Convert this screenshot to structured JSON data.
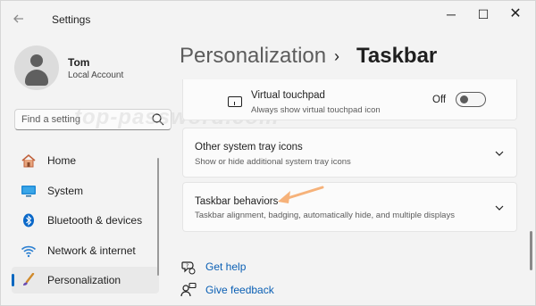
{
  "window": {
    "title": "Settings",
    "controls": {
      "minimize": "─",
      "maximize": "☐",
      "close": "✕"
    }
  },
  "profile": {
    "name": "Tom",
    "account_type": "Local Account"
  },
  "search": {
    "placeholder": "Find a setting"
  },
  "watermark": "top-password.com",
  "sidebar": {
    "items": [
      {
        "label": "Home",
        "icon": "home-icon",
        "active": false
      },
      {
        "label": "System",
        "icon": "system-icon",
        "active": false
      },
      {
        "label": "Bluetooth & devices",
        "icon": "bluetooth-icon",
        "active": false
      },
      {
        "label": "Network & internet",
        "icon": "wifi-icon",
        "active": false
      },
      {
        "label": "Personalization",
        "icon": "brush-icon",
        "active": true
      }
    ]
  },
  "breadcrumb": {
    "parent": "Personalization",
    "separator": "›",
    "current": "Taskbar"
  },
  "settings": {
    "virtual_touchpad": {
      "title": "Virtual touchpad",
      "subtitle": "Always show virtual touchpad icon",
      "state_label": "Off"
    },
    "other_tray": {
      "title": "Other system tray icons",
      "subtitle": "Show or hide additional system tray icons"
    },
    "taskbar_behaviors": {
      "title": "Taskbar behaviors",
      "subtitle": "Taskbar alignment, badging, automatically hide, and multiple displays"
    }
  },
  "links": {
    "help": "Get help",
    "feedback": "Give feedback"
  },
  "colors": {
    "accent": "#0067c0",
    "link": "#0a5fb4",
    "annotation_arrow": "#f6b27a"
  }
}
